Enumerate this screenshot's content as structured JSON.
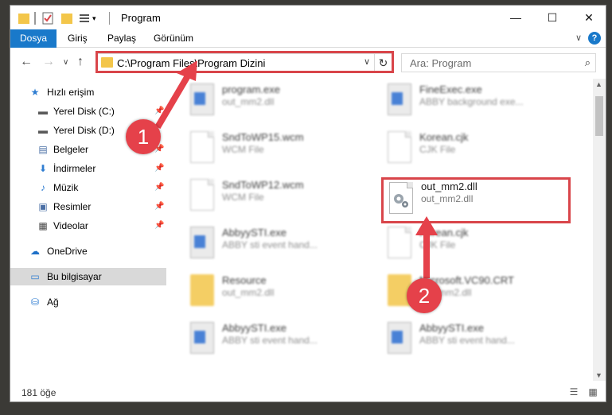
{
  "window": {
    "title": "Program",
    "controls": {
      "minimize": "—",
      "maximize": "☐",
      "close": "✕"
    }
  },
  "ribbon": {
    "tabs": [
      "Dosya",
      "Giriş",
      "Paylaş",
      "Görünüm"
    ],
    "active_tab": "Dosya"
  },
  "address_bar": {
    "path": "C:\\Program Files\\Program Dizini",
    "dropdown": "∨",
    "refresh": "↻"
  },
  "search": {
    "placeholder": "Ara: Program"
  },
  "sidebar": {
    "items": [
      {
        "label": "Hızlı erişim",
        "icon": "star-icon",
        "glyph": "★"
      },
      {
        "label": "Yerel Disk (C:)",
        "icon": "drive-icon",
        "glyph": "▬",
        "pinned": true
      },
      {
        "label": "Yerel Disk (D:)",
        "icon": "drive-icon",
        "glyph": "▬",
        "pinned": false
      },
      {
        "label": "Belgeler",
        "icon": "document-icon",
        "glyph": "▤",
        "pinned": true
      },
      {
        "label": "İndirmeler",
        "icon": "download-icon",
        "glyph": "⬇",
        "pinned": true
      },
      {
        "label": "Müzik",
        "icon": "music-icon",
        "glyph": "♪",
        "pinned": true
      },
      {
        "label": "Resimler",
        "icon": "pictures-icon",
        "glyph": "▣",
        "pinned": true
      },
      {
        "label": "Videolar",
        "icon": "video-icon",
        "glyph": "▦",
        "pinned": true
      },
      {
        "label": "OneDrive",
        "icon": "cloud-icon",
        "glyph": "☁"
      },
      {
        "label": "Bu bilgisayar",
        "icon": "computer-icon",
        "glyph": "▭",
        "selected": true
      },
      {
        "label": "Ağ",
        "icon": "network-icon",
        "glyph": "⛁"
      }
    ]
  },
  "files": [
    {
      "name": "program.exe",
      "desc": "out_mm2.dll",
      "type": "exe"
    },
    {
      "name": "FineExec.exe",
      "desc": "ABBY background exe...",
      "type": "exe"
    },
    {
      "name": "SndToWP15.wcm",
      "desc": "WCM File",
      "type": "doc"
    },
    {
      "name": "Korean.cjk",
      "desc": "CJK File",
      "type": "doc"
    },
    {
      "name": "SndToWP12.wcm",
      "desc": "WCM File",
      "type": "doc"
    },
    {
      "name": "out_mm2.dll",
      "desc": "out_mm2.dll",
      "type": "dll"
    },
    {
      "name": "AbbyySTI.exe",
      "desc": "ABBY sti event hand...",
      "type": "exe"
    },
    {
      "name": "Korean.cjk",
      "desc": "CJK File",
      "type": "doc"
    },
    {
      "name": "Resource",
      "desc": "out_mm2.dll",
      "type": "folder"
    },
    {
      "name": "Microsoft.VC90.CRT",
      "desc": "out_mm2.dll",
      "type": "folder"
    },
    {
      "name": "AbbyySTI.exe",
      "desc": "ABBY sti event hand...",
      "type": "exe"
    },
    {
      "name": "AbbyySTI.exe",
      "desc": "ABBY sti event hand...",
      "type": "exe"
    }
  ],
  "status": {
    "item_count": "181 öğe"
  },
  "markers": [
    "1",
    "2"
  ],
  "colors": {
    "accent": "#1979ca",
    "highlight": "#d9454a",
    "marker": "#e5414a"
  }
}
